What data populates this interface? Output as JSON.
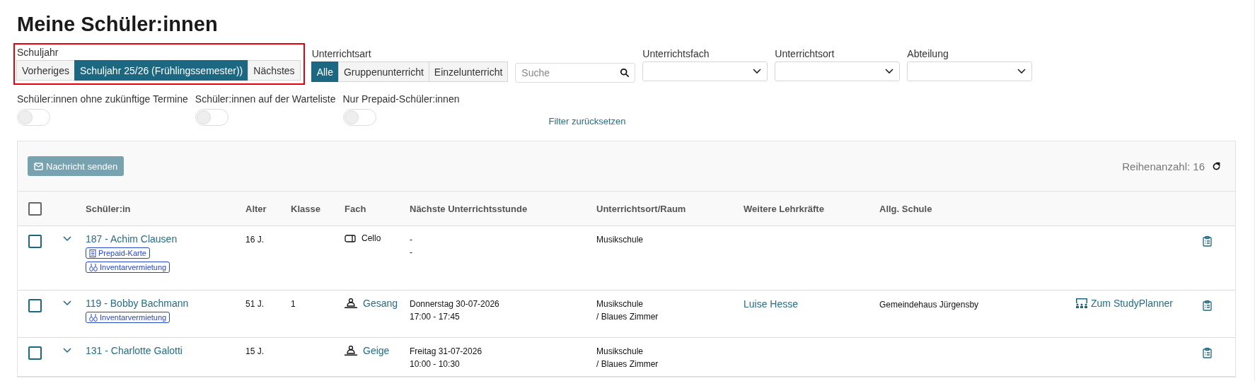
{
  "title": "Meine Schüler:innen",
  "school_year": {
    "label": "Schuljahr",
    "highlighted": true,
    "options": [
      {
        "label": "Vorheriges",
        "selected": false
      },
      {
        "label": "Schuljahr 25/26 (Frühlingssemester))",
        "selected": true
      },
      {
        "label": "Nächstes",
        "selected": false
      }
    ]
  },
  "lesson_type": {
    "label": "Unterrichtsart",
    "options": [
      {
        "label": "Alle",
        "selected": true
      },
      {
        "label": "Gruppenunterricht",
        "selected": false
      },
      {
        "label": "Einzelunterricht",
        "selected": false
      }
    ]
  },
  "search": {
    "placeholder": "Suche"
  },
  "selects": [
    {
      "label": "Unterrichtsfach"
    },
    {
      "label": "Unterrichtsort"
    },
    {
      "label": "Abteilung"
    }
  ],
  "toggles": [
    {
      "label": "Schüler:innen ohne zukünftige Termine",
      "on": false
    },
    {
      "label": "Schüler:innen auf der Warteliste",
      "on": false
    },
    {
      "label": "Nur Prepaid-Schüler:innen",
      "on": false
    }
  ],
  "reset_link": "Filter zurücksetzen",
  "toolbar": {
    "send_button": "Nachricht senden",
    "row_count": "Reihenanzahl: 16"
  },
  "table": {
    "all_checked": false,
    "columns": [
      "Schüler:in",
      "Alter",
      "Klasse",
      "Fach",
      "Nächste Unterrichtsstunde",
      "Unterrichtsort/Raum",
      "Weitere Lehrkräfte",
      "Allg. Schule"
    ],
    "rows": [
      {
        "checked": false,
        "name": "187 - Achim Clausen",
        "tags": [
          {
            "kind": "prepaid",
            "label": "Prepaid-Karte"
          },
          {
            "kind": "rental",
            "label": "Inventarvermietung"
          }
        ],
        "age": "16 J.",
        "class": "",
        "subject": {
          "kind": "instrument",
          "label": "Cello",
          "linked": false
        },
        "next_lesson": [
          "-",
          "-"
        ],
        "location": [
          "Musikschule"
        ],
        "teachers": "",
        "school": "",
        "study_planner": ""
      },
      {
        "checked": false,
        "name": "119 - Bobby Bachmann",
        "tags": [
          {
            "kind": "rental",
            "label": "Inventarvermietung"
          }
        ],
        "age": "51 J.",
        "class": "1",
        "subject": {
          "kind": "teacher",
          "label": "Gesang",
          "linked": true
        },
        "next_lesson": [
          "Donnerstag 30-07-2026",
          "17:00 - 17:45"
        ],
        "location": [
          "Musikschule",
          "/ Blaues Zimmer"
        ],
        "teachers": "Luise Hesse",
        "school": "Gemeindehaus Jürgensby",
        "study_planner": "Zum StudyPlanner"
      },
      {
        "checked": false,
        "name": "131 - Charlotte Galotti",
        "tags": [],
        "age": "15 J.",
        "class": "",
        "subject": {
          "kind": "teacher",
          "label": "Geige",
          "linked": true
        },
        "next_lesson": [
          "Freitag 31-07-2026",
          "10:00 - 10:30"
        ],
        "location": [
          "Musikschule",
          "/ Blaues Zimmer"
        ],
        "teachers": "",
        "school": "",
        "study_planner": ""
      }
    ]
  }
}
